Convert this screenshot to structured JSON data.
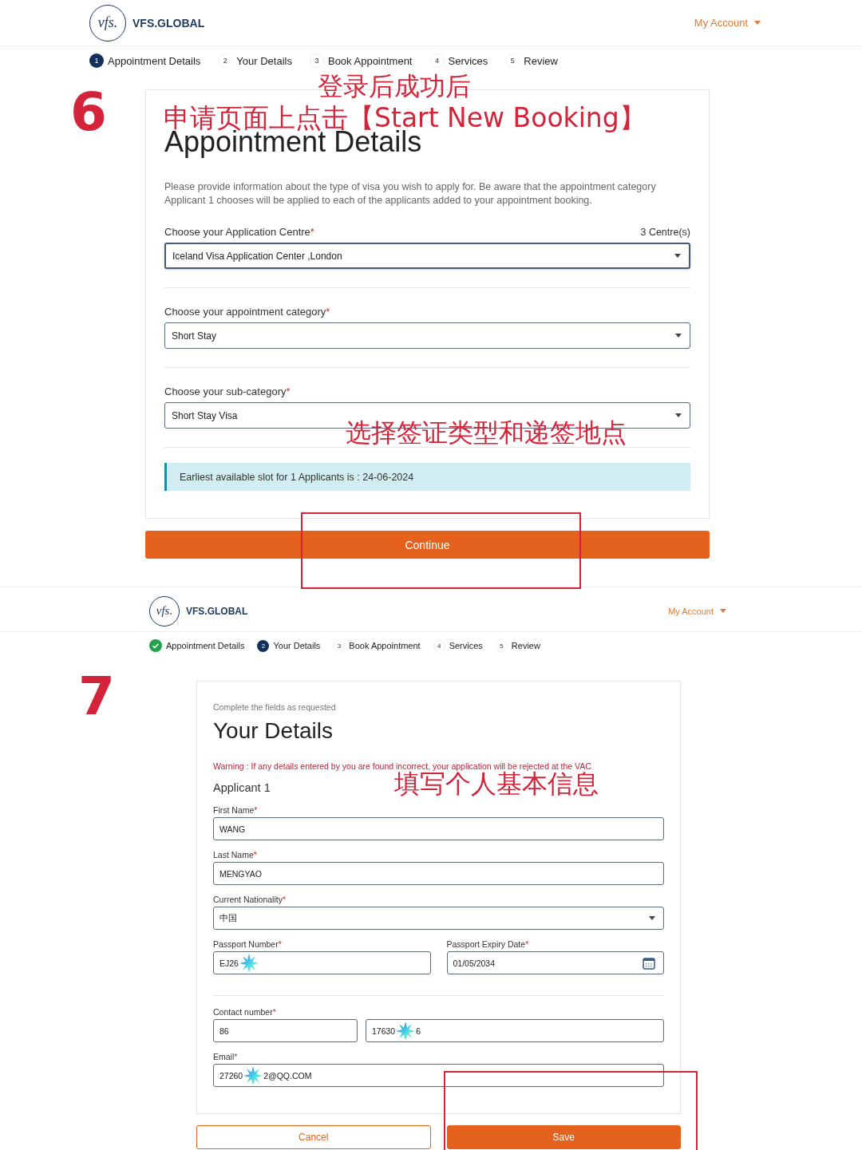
{
  "appointment_screen": {
    "header": {
      "logo": "vfs.",
      "brand": "VFS.GLOBAL",
      "account": "My Account"
    },
    "steps": [
      {
        "number": "1",
        "label": "Appointment Details",
        "completed": false,
        "selected": true
      },
      {
        "number": "2",
        "label": "Your Details",
        "completed": false,
        "selected": false
      },
      {
        "number": "3",
        "label": "Book Appointment",
        "completed": false,
        "selected": false
      },
      {
        "number": "4",
        "label": "Services",
        "completed": false,
        "selected": false
      },
      {
        "number": "5",
        "label": "Review",
        "completed": false,
        "selected": false
      }
    ],
    "title": "Appointment Details",
    "description": "Please provide information about the type of visa you wish to apply for. Be aware that the appointment category Applicant 1 chooses will be applied to each of the applicants added to your appointment booking.",
    "fields": [
      {
        "label": "Choose your Application Centre",
        "mark": "*",
        "count": "3 Centre(s)",
        "kind": "select",
        "value": "Iceland Visa Application Center ,London",
        "focused": true
      },
      {
        "label": "Choose your appointment category",
        "mark": "*",
        "kind": "select",
        "value": "Short Stay",
        "focused": false
      },
      {
        "label": "Choose your sub-category",
        "mark": "*",
        "kind": "select",
        "value": "Short Stay Visa",
        "focused": false
      }
    ],
    "info": "Earliest available slot for 1 Applicants is : 24-06-2024",
    "button": "Continue"
  },
  "details_screen": {
    "header": {
      "logo": "vfs.",
      "brand": "VFS.GLOBAL",
      "account": "My Account"
    },
    "steps": [
      {
        "label": "Appointment Details",
        "completed": true,
        "selected": false
      },
      {
        "number": "2",
        "label": "Your Details",
        "completed": false,
        "selected": true
      },
      {
        "number": "3",
        "label": "Book Appointment",
        "completed": false,
        "selected": false
      },
      {
        "number": "4",
        "label": "Services",
        "completed": false,
        "selected": false
      },
      {
        "number": "5",
        "label": "Review",
        "completed": false,
        "selected": false
      }
    ],
    "subtitle": "Complete the fields as requested",
    "title": "Your Details",
    "warning": "Warning : If any details entered by you are found incorrect, your application will be rejected at the VAC",
    "applicant": "Applicant 1",
    "first_name": {
      "label": "First Name",
      "mark": "*",
      "value": "WANG"
    },
    "last_name": {
      "label": "Last Name",
      "mark": "*",
      "value": "MENGYAO"
    },
    "nationality": {
      "label": "Current Nationality",
      "mark": "*",
      "kind": "select",
      "value": "中国"
    },
    "passport_number": {
      "label": "Passport Number",
      "mark": "*",
      "value": "EJ26",
      "masked": true
    },
    "passport_expiry": {
      "label": "Passport Expiry Date",
      "mark": "*",
      "kind": "date",
      "value": "01/05/2034"
    },
    "contact": {
      "label": "Contact number",
      "mark": "*",
      "code": "86",
      "number": "17630",
      "number_end": "6",
      "masked": true
    },
    "email": {
      "label": "Email",
      "mark": "*",
      "value": "27260",
      "value_end": "2@QQ.COM",
      "masked": true
    },
    "buttons": [
      {
        "label": "Cancel",
        "kind": "secondary"
      },
      {
        "label": "Save",
        "kind": "primary"
      }
    ]
  },
  "annotations": {
    "step_numbers": [
      "6",
      "7"
    ],
    "captions": [
      "登录后成功后",
      "申请页面上点击【Start New Booking】",
      "选择签证类型和递签地点",
      "填写个人基本信息"
    ]
  }
}
